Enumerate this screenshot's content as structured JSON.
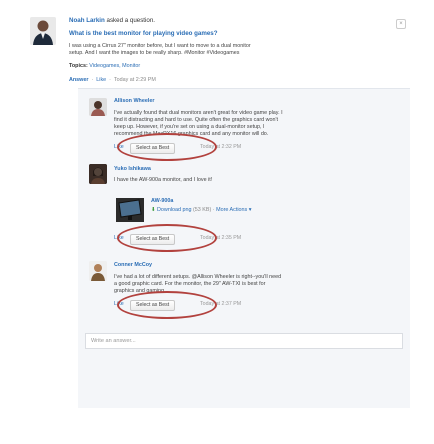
{
  "question": {
    "author": "Noah Larkin",
    "action_text": "asked a question.",
    "title": "What is the best monitor for playing video games?",
    "body_line1": "I was using a Cirrus 27\" monitor before, but I want to move to a dual monitor",
    "body_line2": "setup. And I want the images to be really sharp. #Monitor #Videogames",
    "topics_label": "Topics:",
    "topics_value": "Videogames, Monitor",
    "answer_label": "Answer",
    "like_label": "Like",
    "timestamp": "Today at 2:29 PM",
    "close_icon_glyph": "×"
  },
  "answers": [
    {
      "author": "Allison Wheeler",
      "lines": [
        "I've actually found that dual monitors aren't great for video game play. I",
        "find it distracting and hard to use. Quite often the graphics card won't",
        "keep up. However, if you're set on using a dual-monitor setup, I",
        "recommend the MaxPX16 graphics card and any monitor will do."
      ],
      "like": "Like",
      "select_label": "Select as Best",
      "timestamp": "Today at 2:32 PM"
    },
    {
      "author": "Yuko Ishikawa",
      "lines": [
        "I have the AW-900a monitor, and I love it!"
      ],
      "attachment_name": "AW-900a",
      "download_label": "Download png",
      "file_size": "(53 KB)",
      "more_actions": "More Actions",
      "like": "Like",
      "select_label": "Select as Best",
      "timestamp": "Today at 2:35 PM"
    },
    {
      "author": "Conner McCoy",
      "lines": [
        "I've had a lot of different setups. @Allison Wheeler is right--you'll need",
        "a good graphic card. For the monitor, the 29\" AW-TXI is best for",
        "graphics and gaming."
      ],
      "like": "Like",
      "select_label": "Select as Best",
      "timestamp": "Today at 2:37 PM"
    }
  ],
  "answer_input": {
    "placeholder": "Write an answer..."
  },
  "colors": {
    "link": "#2a6db5",
    "highlight_oval": "#b2423e",
    "panel_bg": "#f4f6f9"
  }
}
